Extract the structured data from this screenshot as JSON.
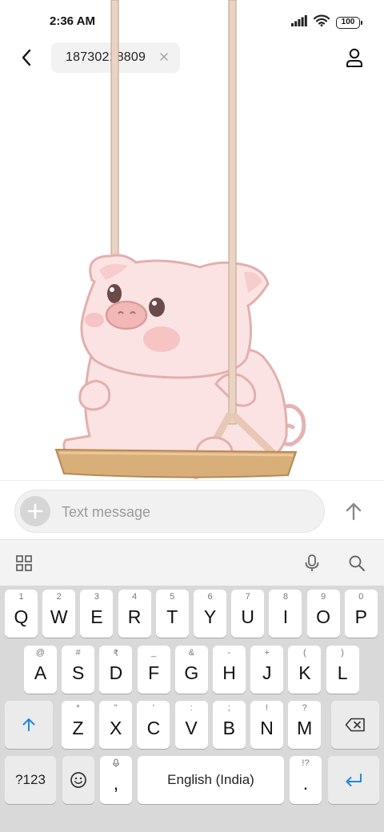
{
  "status_bar": {
    "time": "2:36 AM",
    "battery": "100",
    "icons": [
      "signal-icon",
      "wifi-icon",
      "battery-icon"
    ]
  },
  "header": {
    "recipient": "18730218809",
    "icons": [
      "back-arrow-icon",
      "close-icon",
      "contact-icon"
    ]
  },
  "message": {
    "sticker": "pig-on-swing-sticker"
  },
  "compose": {
    "placeholder": "Text message",
    "icons": [
      "plus-icon",
      "send-arrow-icon"
    ]
  },
  "keyboard_toolbar": {
    "icons": [
      "grid-icon",
      "microphone-icon",
      "search-icon"
    ]
  },
  "keyboard": {
    "row1": [
      {
        "key": "Q",
        "hint": "1"
      },
      {
        "key": "W",
        "hint": "2"
      },
      {
        "key": "E",
        "hint": "3"
      },
      {
        "key": "R",
        "hint": "4"
      },
      {
        "key": "T",
        "hint": "5"
      },
      {
        "key": "Y",
        "hint": "6"
      },
      {
        "key": "U",
        "hint": "7"
      },
      {
        "key": "I",
        "hint": "8"
      },
      {
        "key": "O",
        "hint": "9"
      },
      {
        "key": "P",
        "hint": "0"
      }
    ],
    "row2": [
      {
        "key": "A",
        "hint": "@"
      },
      {
        "key": "S",
        "hint": "#"
      },
      {
        "key": "D",
        "hint": "₹"
      },
      {
        "key": "F",
        "hint": "_"
      },
      {
        "key": "G",
        "hint": "&"
      },
      {
        "key": "H",
        "hint": "-"
      },
      {
        "key": "J",
        "hint": "+"
      },
      {
        "key": "K",
        "hint": "("
      },
      {
        "key": "L",
        "hint": ")"
      }
    ],
    "row3": [
      {
        "key": "Z",
        "hint": "*"
      },
      {
        "key": "X",
        "hint": "\""
      },
      {
        "key": "C",
        "hint": "'"
      },
      {
        "key": "V",
        "hint": ":"
      },
      {
        "key": "B",
        "hint": ";"
      },
      {
        "key": "N",
        "hint": "!"
      },
      {
        "key": "M",
        "hint": "?"
      }
    ],
    "symbols_label": "?123",
    "comma": ",",
    "space_label": "English (India)",
    "period": ".",
    "period_hint": "!?",
    "accent_color": "#1e88e5"
  }
}
